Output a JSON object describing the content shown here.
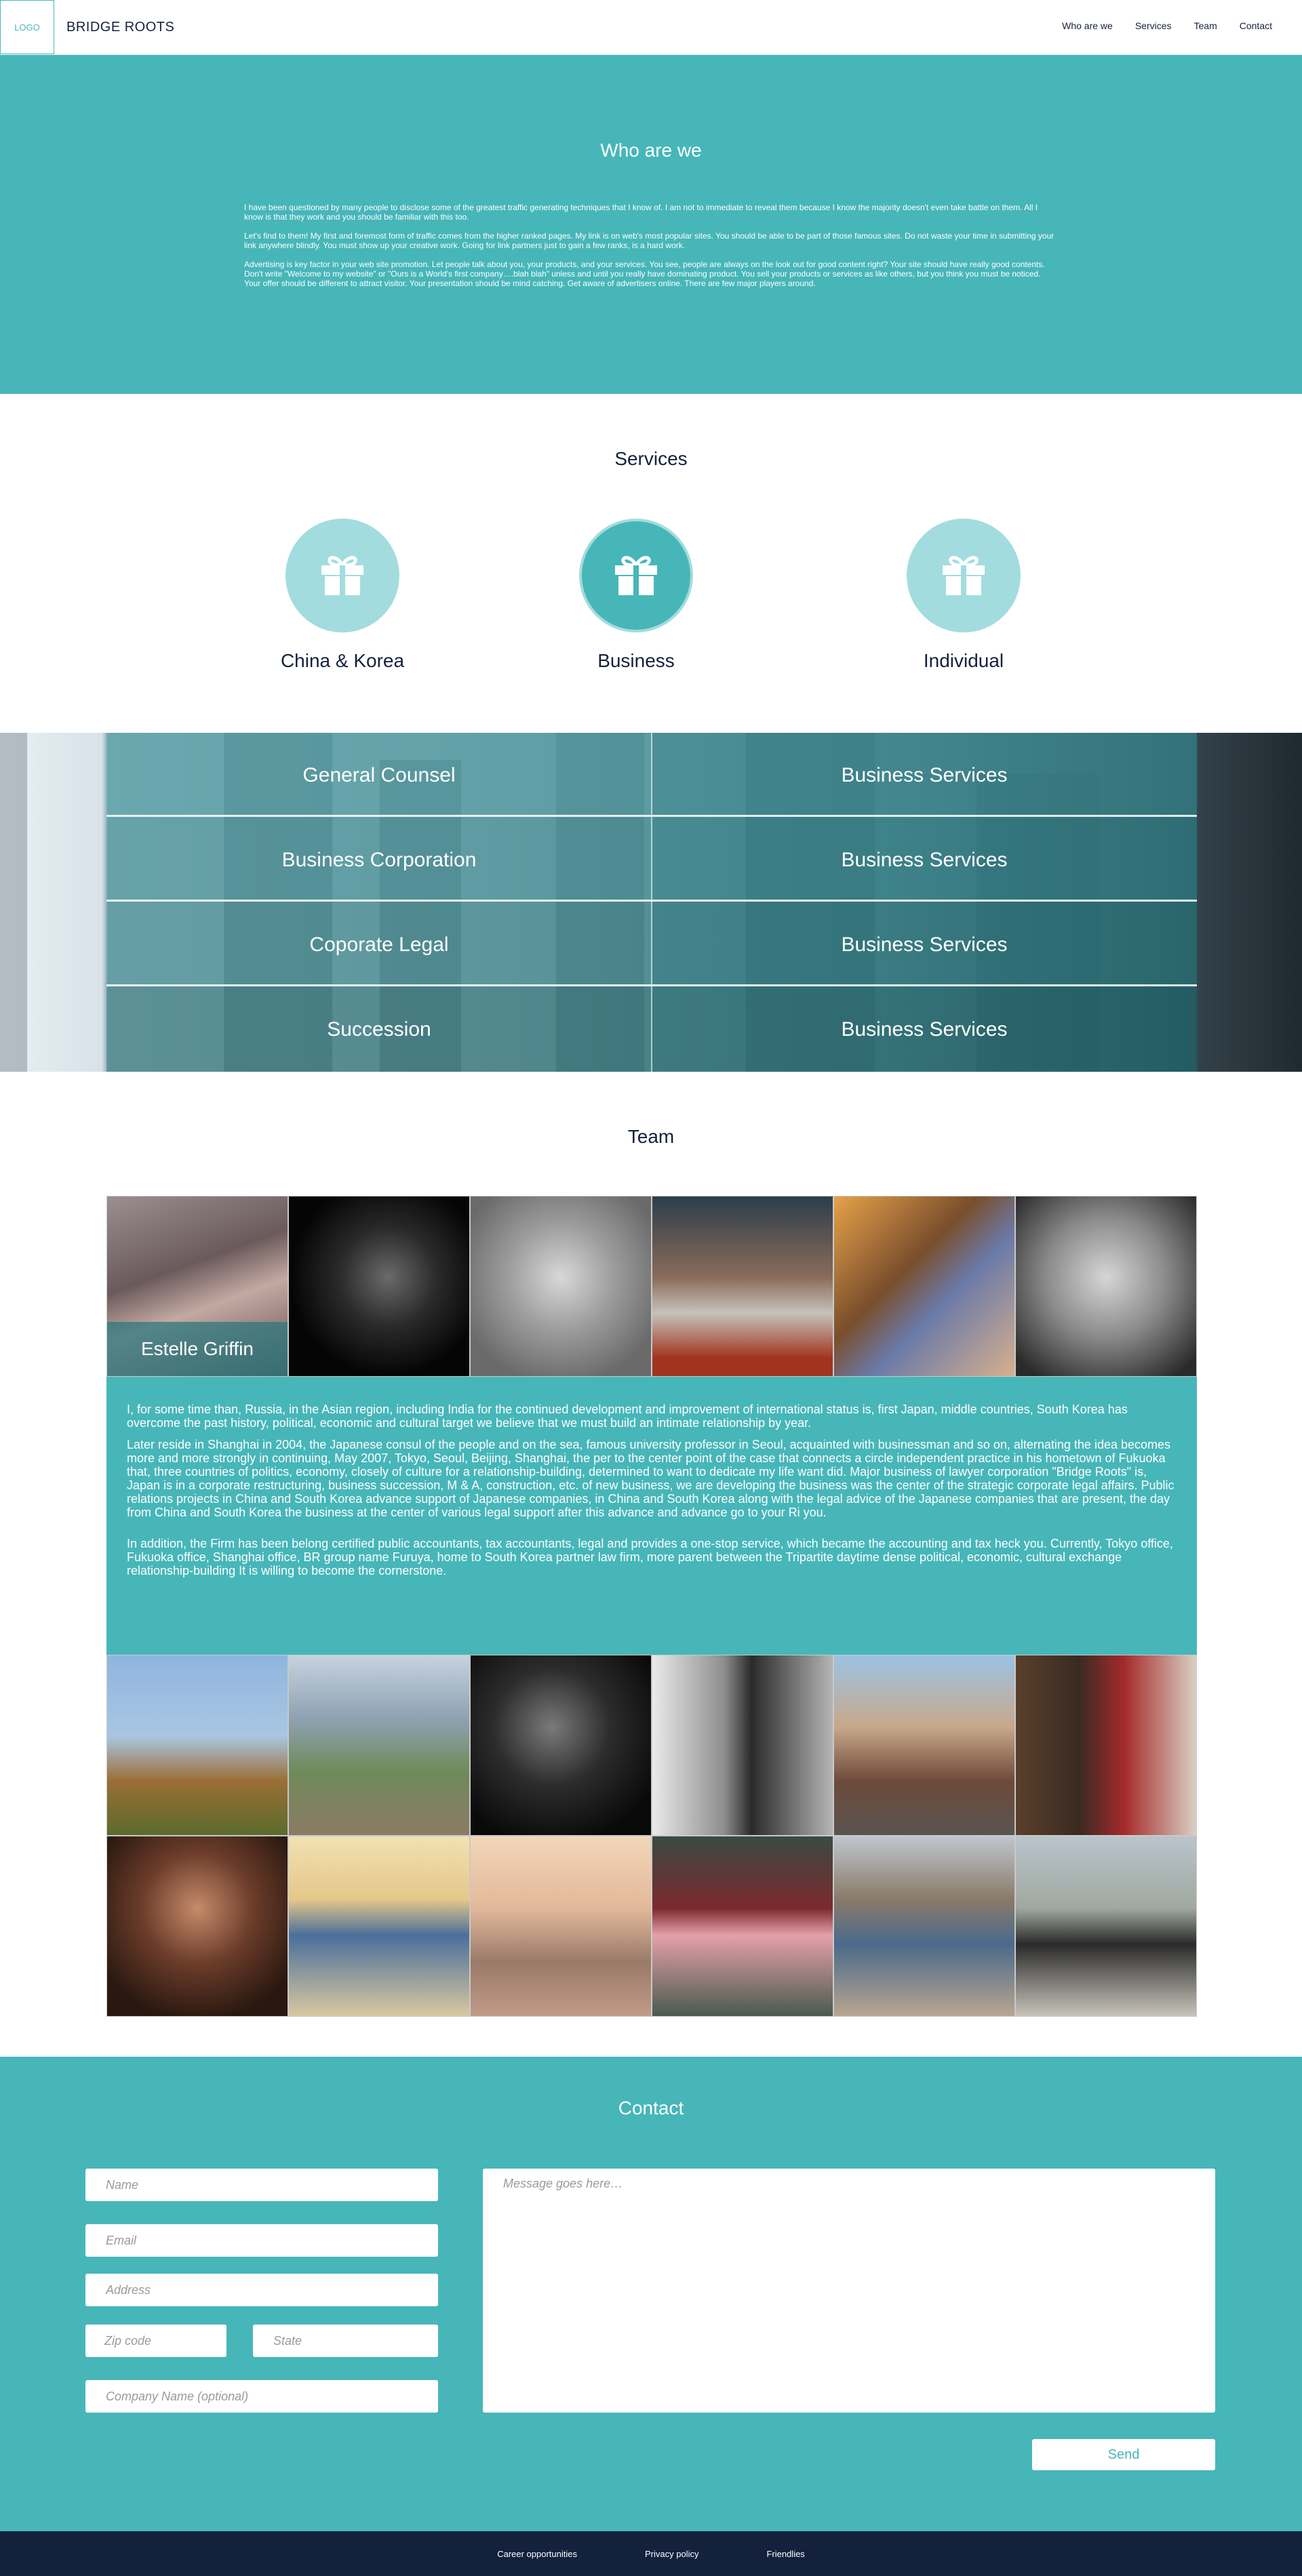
{
  "header": {
    "logo": "LOGO",
    "brand": "BRIDGE ROOTS",
    "nav": [
      "Who are we",
      "Services",
      "Team",
      "Contact"
    ]
  },
  "who": {
    "title": "Who are we",
    "paragraphs": [
      "I have been questioned by many people to disclose some of the greatest traffic generating techniques that I know of. I am not to immediate to reveal them because I know the majority doesn't even take battle on them. All I know is that they work and you should be familiar with this too.",
      "Let's find to them! My first and foremost form of traffic comes from the higher ranked pages. My link is on web's most popular sites. You should be able to be part of those famous sites. Do not waste your time in submitting your link anywhere blindly. You must show up your creative work. Going for link partners just to gain a few ranks, is a hard work.",
      "Advertising is key factor in your web site promotion. Let people talk about you, your products, and your services. You see, people are always on the look out for good content right? Your site should have really good contents. Don't write \"Welcome to my website\" or \"Ours is a World's first company….blah blah\" unless and until you really have dominating product. You sell your products or services as like others, but you think you must be noticed. Your offer should be different to attract visitor. Your presentation should be mind catching. Get aware of advertisers online. There are few major players around."
    ]
  },
  "services": {
    "title": "Services",
    "items": [
      "China & Korea",
      "Business",
      "Individual"
    ],
    "icon": "gift-icon"
  },
  "counsel": {
    "left": [
      "General Counsel",
      "Business Corporation",
      "Coporate Legal",
      "Succession"
    ],
    "right": [
      "Business Services",
      "Business Services",
      "Business Services",
      "Business Services"
    ]
  },
  "team": {
    "title": "Team",
    "featured_name": "Estelle Griffin",
    "bio": [
      "I, for some time than, Russia, in the Asian region, including India for the continued development and improvement of international status is, first Japan, middle countries, South Korea has overcome the past history, political, economic and cultural target we believe that we must build an intimate relationship by year.",
      "Later reside in Shanghai in 2004, the Japanese consul of the people and on the sea, famous university professor in Seoul, acquainted with businessman and so on, alternating the idea becomes more and more strongly in continuing, May 2007, Tokyo, Seoul, Beijing, Shanghai, the per to the center point of the case that connects a circle independent practice in his hometown of Fukuoka that, three countries of politics, economy, closely of culture for a relationship-building, determined to want to dedicate my life want did. Major business of lawyer corporation \"Bridge Roots\" is, Japan is in a corporate restructuring, business succession, M & A, construction, etc. of new business, we are developing the business was the center of the strategic corporate legal affairs. Public relations projects in China and South Korea advance support of Japanese companies, in China and South Korea along with the legal advice of the Japanese companies that are present, the day from China and South Korea the business at the center of various legal support after this advance and advance go to your Ri you.",
      "In addition, the Firm has been belong certified public accountants, tax accountants, legal and provides a one-stop service, which became the accounting and tax heck you. Currently, Tokyo office, Fukuoka office, Shanghai office, BR group name Furuya, home to South Korea partner law firm, more parent between the Tripartite daytime dense political, economic, cultural exchange relationship-building It is willing to become the cornerstone."
    ]
  },
  "contact": {
    "title": "Contact",
    "name_placeholder": "Name",
    "email_placeholder": "Email",
    "address_placeholder": "Address",
    "zip_placeholder": "Zip code",
    "state_placeholder": "State",
    "company_placeholder": "Company Name (optional)",
    "message_placeholder": "Message goes here…",
    "send_label": "Send"
  },
  "footer": {
    "links": [
      "Career opportunities",
      "Privacy policy",
      "Friendlies"
    ]
  },
  "colors": {
    "teal": "#47b6b9",
    "light_teal": "#a3dcdf",
    "navy": "#14213d"
  }
}
